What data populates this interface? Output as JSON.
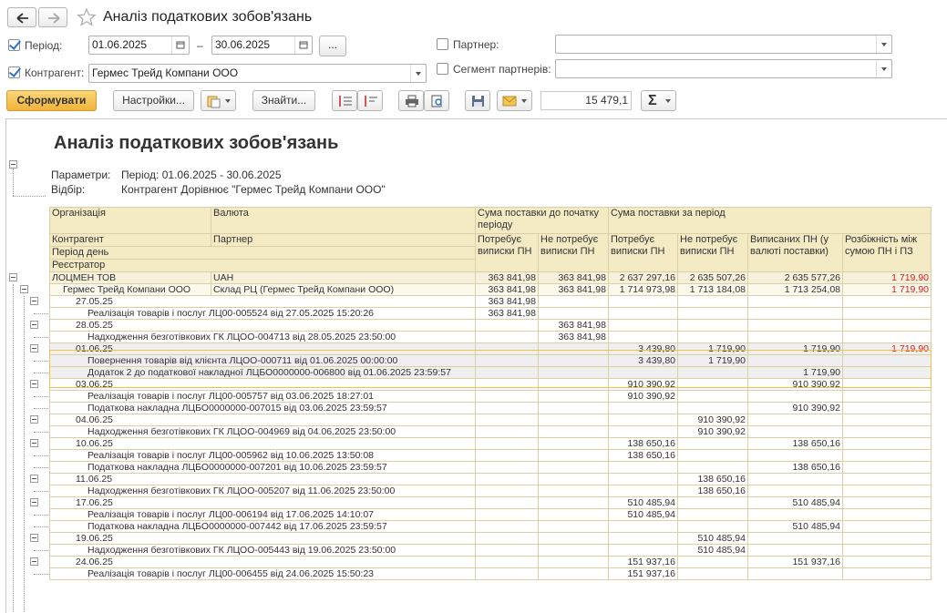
{
  "window": {
    "title": "Аналіз податкових зобов'язань"
  },
  "filters": {
    "period_label": "Період:",
    "period_from": "01.06.2025",
    "period_to": "30.06.2025",
    "period_dash": "–",
    "period_more": "...",
    "counterparty_label": "Контрагент:",
    "counterparty_value": "Гермес Трейд Компани ООО",
    "partner_label": "Партнер:",
    "partner_value": "",
    "segment_label": "Сегмент партнерів:",
    "segment_value": ""
  },
  "toolbar": {
    "generate": "Сформувати",
    "settings": "Настройки...",
    "find": "Знайти...",
    "sum_value": "15 479,1",
    "sigma": "Σ"
  },
  "report": {
    "title": "Аналіз податкових зобов'язань",
    "params_label": "Параметри:",
    "params_value": "Період: 01.06.2025 - 30.06.2025",
    "filter_label": "Відбір:",
    "filter_value": "Контрагент Дорівнює \"Гермес Трейд Компани ООО\"",
    "headers": {
      "org": "Організація",
      "currency": "Валюта",
      "sum_start": "Сума поставки до початку періоду",
      "sum_period": "Сума поставки за період",
      "counterparty": "Контрагент",
      "partner": "Партнер",
      "period_day": "Період день",
      "registrar": "Реєстратор",
      "need_start": "Потребує виписки ПН",
      "noneed_start": "Не потребує виписки ПН",
      "need_period": "Потребує виписки ПН",
      "noneed_period": "Не потребує виписки ПН",
      "issued": "Виписаних ПН (у валюті поставки)",
      "diff": "Розбіжність між сумою ПН і ПЗ"
    },
    "rows": [
      {
        "level": 1,
        "c1": "ЛОЦМЕН ТОВ",
        "c2": "UAH",
        "a": "363 841,98",
        "b": "363 841,98",
        "c": "2 637 297,16",
        "d": "2 635 507,26",
        "e": "2 635 577,26",
        "f": "1 719,90"
      },
      {
        "level": 2,
        "c1": "Гермес Трейд Компани ООО",
        "c2": "Склад РЦ (Гермес Трейд Компани ООО)",
        "a": "363 841,98",
        "b": "363 841,98",
        "c": "1 714 973,98",
        "d": "1 713 184,08",
        "e": "1 713 254,08",
        "f": "1 719,90"
      },
      {
        "level": 3,
        "c1": "27.05.25",
        "c2": "",
        "a": "363 841,98",
        "b": "",
        "c": "",
        "d": "",
        "e": "",
        "f": ""
      },
      {
        "level": 4,
        "c1": "Реалізація товарів і послуг ЛЦ00-005524 від 27.05.2025 15:20:26",
        "c2": "",
        "a": "363 841,98",
        "b": "",
        "c": "",
        "d": "",
        "e": "",
        "f": ""
      },
      {
        "level": 3,
        "c1": "28.05.25",
        "c2": "",
        "a": "",
        "b": "363 841,98",
        "c": "",
        "d": "",
        "e": "",
        "f": ""
      },
      {
        "level": 4,
        "c1": "Надходження безготівкових ГК ЛЦОО-004713 від 28.05.2025 23:50:00",
        "c2": "",
        "a": "",
        "b": "363 841,98",
        "c": "",
        "d": "",
        "e": "",
        "f": ""
      },
      {
        "level": 3,
        "sel": true,
        "c1": "01.06.25",
        "c2": "",
        "a": "",
        "b": "",
        "c": "3 439,80",
        "d": "1 719,90",
        "e": "1 719,90",
        "f": "1 719,90"
      },
      {
        "level": 4,
        "sel": true,
        "c1": "Повернення товарів від клієнта ЛЦОО-000711 від 01.06.2025 00:00:00",
        "c2": "",
        "a": "",
        "b": "",
        "c": "3 439,80",
        "d": "1 719,90",
        "e": "",
        "f": ""
      },
      {
        "level": 4,
        "sel": true,
        "c1": "Додаток 2 до податкової накладної ЛЦБО0000000-006800 від 01.06.2025 23:59:57",
        "c2": "",
        "a": "",
        "b": "",
        "c": "",
        "d": "",
        "e": "1 719,90",
        "f": ""
      },
      {
        "level": 3,
        "c1": "03.06.25",
        "c2": "",
        "a": "",
        "b": "",
        "c": "910 390,92",
        "d": "",
        "e": "910 390,92",
        "f": ""
      },
      {
        "level": 4,
        "c1": "Реалізація товарів і послуг ЛЦ00-005757 від 03.06.2025 18:27:01",
        "c2": "",
        "a": "",
        "b": "",
        "c": "910 390,92",
        "d": "",
        "e": "",
        "f": ""
      },
      {
        "level": 4,
        "c1": "Податкова накладна ЛЦБО0000000-007015 від 03.06.2025 23:59:57",
        "c2": "",
        "a": "",
        "b": "",
        "c": "",
        "d": "",
        "e": "910 390,92",
        "f": ""
      },
      {
        "level": 3,
        "c1": "04.06.25",
        "c2": "",
        "a": "",
        "b": "",
        "c": "",
        "d": "910 390,92",
        "e": "",
        "f": ""
      },
      {
        "level": 4,
        "c1": "Надходження безготівкових ГК ЛЦОО-004969 від 04.06.2025 23:50:00",
        "c2": "",
        "a": "",
        "b": "",
        "c": "",
        "d": "910 390,92",
        "e": "",
        "f": ""
      },
      {
        "level": 3,
        "c1": "10.06.25",
        "c2": "",
        "a": "",
        "b": "",
        "c": "138 650,16",
        "d": "",
        "e": "138 650,16",
        "f": ""
      },
      {
        "level": 4,
        "c1": "Реалізація товарів і послуг ЛЦ00-005962 від 10.06.2025 13:50:08",
        "c2": "",
        "a": "",
        "b": "",
        "c": "138 650,16",
        "d": "",
        "e": "",
        "f": ""
      },
      {
        "level": 4,
        "c1": "Податкова накладна ЛЦБО0000000-007201 від 10.06.2025 23:59:57",
        "c2": "",
        "a": "",
        "b": "",
        "c": "",
        "d": "",
        "e": "138 650,16",
        "f": ""
      },
      {
        "level": 3,
        "c1": "11.06.25",
        "c2": "",
        "a": "",
        "b": "",
        "c": "",
        "d": "138 650,16",
        "e": "",
        "f": ""
      },
      {
        "level": 4,
        "c1": "Надходження безготівкових ГК ЛЦОО-005207 від 11.06.2025 23:50:00",
        "c2": "",
        "a": "",
        "b": "",
        "c": "",
        "d": "138 650,16",
        "e": "",
        "f": ""
      },
      {
        "level": 3,
        "c1": "17.06.25",
        "c2": "",
        "a": "",
        "b": "",
        "c": "510 485,94",
        "d": "",
        "e": "510 485,94",
        "f": ""
      },
      {
        "level": 4,
        "c1": "Реалізація товарів і послуг ЛЦ00-006194 від 17.06.2025 14:10:07",
        "c2": "",
        "a": "",
        "b": "",
        "c": "510 485,94",
        "d": "",
        "e": "",
        "f": ""
      },
      {
        "level": 4,
        "c1": "Податкова накладна ЛЦБО0000000-007442 від 17.06.2025 23:59:57",
        "c2": "",
        "a": "",
        "b": "",
        "c": "",
        "d": "",
        "e": "510 485,94",
        "f": ""
      },
      {
        "level": 3,
        "c1": "19.06.25",
        "c2": "",
        "a": "",
        "b": "",
        "c": "",
        "d": "510 485,94",
        "e": "",
        "f": ""
      },
      {
        "level": 4,
        "c1": "Надходження безготівкових ГК ЛЦОО-005443 від 19.06.2025 23:50:00",
        "c2": "",
        "a": "",
        "b": "",
        "c": "",
        "d": "510 485,94",
        "e": "",
        "f": ""
      },
      {
        "level": 3,
        "c1": "24.06.25",
        "c2": "",
        "a": "",
        "b": "",
        "c": "151 937,16",
        "d": "",
        "e": "151 937,16",
        "f": ""
      },
      {
        "level": 4,
        "c1": "Реалізація товарів і послуг ЛЦ00-006455 від 24.06.2025 15:50:23",
        "c2": "",
        "a": "",
        "b": "",
        "c": "151 937,16",
        "d": "",
        "e": "",
        "f": ""
      }
    ]
  },
  "colors": {
    "accent": "#f0b43a",
    "header_bg": "#f4ebc5",
    "red": "#e0201e",
    "check": "#2a73c6"
  }
}
